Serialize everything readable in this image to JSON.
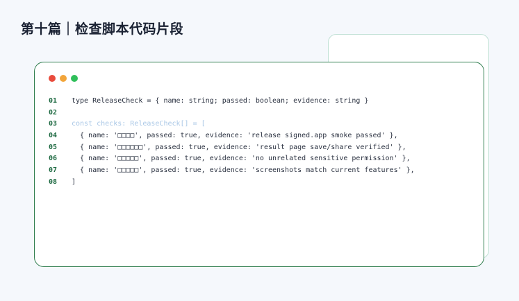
{
  "title": "第十篇｜检查脚本代码片段",
  "colors": {
    "dot_red": "#e94b3c",
    "dot_yellow": "#f2a53a",
    "dot_green": "#2fbf5a",
    "line_number": "#1e6a42",
    "window_border": "#2f7d4e"
  },
  "code_lines": [
    {
      "n": "01",
      "text": "type ReleaseCheck = { name: string; passed: boolean; evidence: string }",
      "faded": false
    },
    {
      "n": "02",
      "text": "",
      "faded": false
    },
    {
      "n": "03",
      "text": "const checks: ReleaseCheck[] = [",
      "faded": true
    },
    {
      "n": "04",
      "text": "  { name: '□□□□', passed: true, evidence: 'release signed.app smoke passed' },",
      "faded": false
    },
    {
      "n": "05",
      "text": "  { name: '□□□□□□', passed: true, evidence: 'result page save/share verified' },",
      "faded": false
    },
    {
      "n": "06",
      "text": "  { name: '□□□□□', passed: true, evidence: 'no unrelated sensitive permission' },",
      "faded": false
    },
    {
      "n": "07",
      "text": "  { name: '□□□□□', passed: true, evidence: 'screenshots match current features' },",
      "faded": false
    },
    {
      "n": "08",
      "text": "]",
      "faded": false
    }
  ]
}
